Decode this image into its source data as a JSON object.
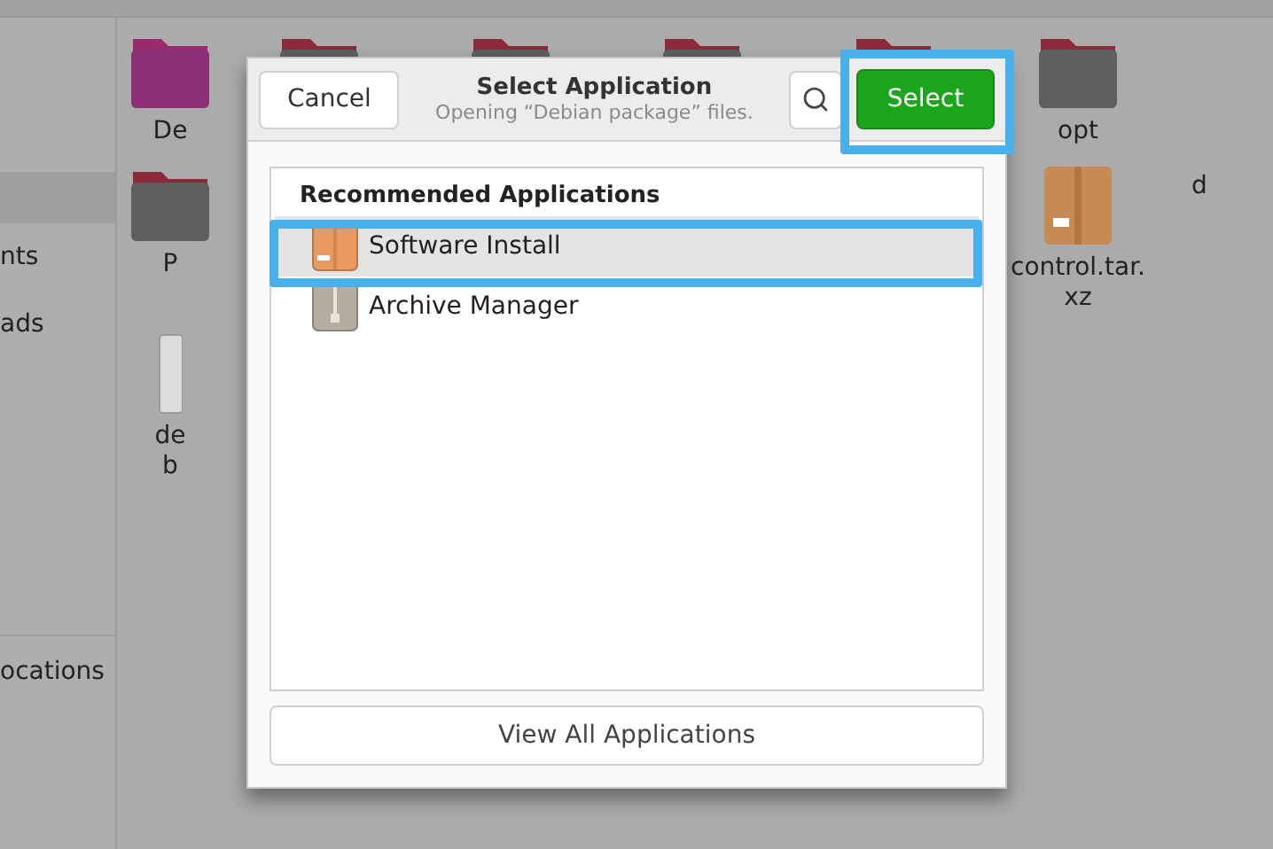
{
  "sidebar": {
    "items": [
      {
        "selected": true
      },
      {
        "label": "nts",
        "selected": false
      },
      {
        "label": "ads",
        "selected": false
      }
    ],
    "footer_items": [
      "ocations"
    ]
  },
  "files": [
    {
      "kind": "folder-purple",
      "lines": [
        "De"
      ]
    },
    {
      "kind": "folder"
    },
    {
      "kind": "folder"
    },
    {
      "kind": "folder"
    },
    {
      "kind": "folder"
    },
    {
      "kind": "folder-dark",
      "lines": [
        "opt"
      ]
    },
    {
      "kind": "folder",
      "lines": [
        "P"
      ]
    },
    {
      "kind": "archive",
      "lines": [
        "control.tar.",
        "xz"
      ]
    },
    {
      "kind": "none",
      "lines": [
        "d"
      ]
    },
    {
      "kind": "file",
      "lines": [
        "de",
        "b"
      ]
    }
  ],
  "dialog": {
    "title": "Select Application",
    "subtitle": "Opening “Debian package” files.",
    "cancel": "Cancel",
    "confirm": "Select",
    "section": "Recommended Applications",
    "apps": [
      {
        "name": "Software Install",
        "kind": "package",
        "selected": true
      },
      {
        "name": "Archive Manager",
        "kind": "zip",
        "selected": false
      }
    ],
    "view_all": "View All Applications"
  }
}
